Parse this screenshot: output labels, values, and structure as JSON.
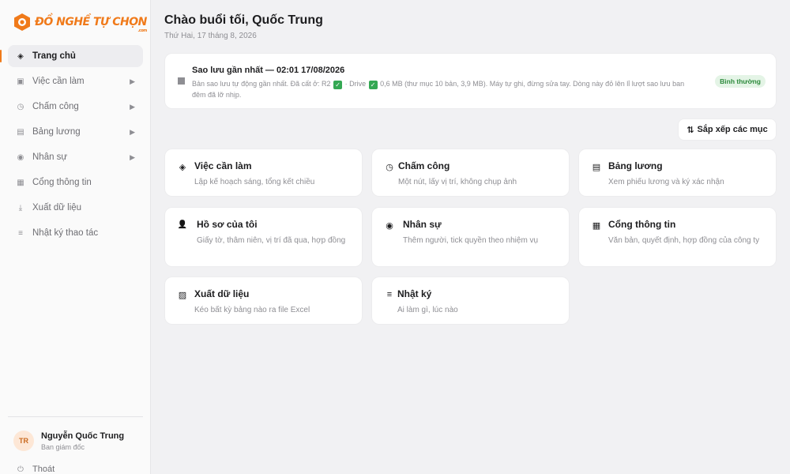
{
  "brand": {
    "name": "ĐỒ NGHỀ TỰ CHỌN",
    "sub": ".com"
  },
  "sidebar": {
    "items": [
      {
        "label": "Trang chủ",
        "icon": "diamond-icon",
        "glyph": "◈",
        "active": true,
        "arrow": false
      },
      {
        "label": "Việc cần làm",
        "icon": "square-icon",
        "glyph": "▣",
        "active": false,
        "arrow": true
      },
      {
        "label": "Chấm công",
        "icon": "clock-icon",
        "glyph": "◷",
        "active": false,
        "arrow": true
      },
      {
        "label": "Bảng lương",
        "icon": "grid-icon",
        "glyph": "▤",
        "active": false,
        "arrow": true
      },
      {
        "label": "Nhân sự",
        "icon": "circle-icon",
        "glyph": "◉",
        "active": false,
        "arrow": true
      },
      {
        "label": "Cổng thông tin",
        "icon": "block-icon",
        "glyph": "▦",
        "active": false,
        "arrow": false
      },
      {
        "label": "Xuất dữ liệu",
        "icon": "download-icon",
        "glyph": "⤓",
        "active": false,
        "arrow": false
      },
      {
        "label": "Nhật ký thao tác",
        "icon": "list-icon",
        "glyph": "≡",
        "active": false,
        "arrow": false
      }
    ],
    "arrow_glyph": "▶",
    "user": {
      "initials": "TR",
      "name": "Nguyễn Quốc Trung",
      "role": "Ban giám đốc"
    },
    "logout": {
      "label": "Thoát",
      "glyph": "⏻"
    }
  },
  "header": {
    "greeting": "Chào buổi tối, Quốc Trung",
    "date": "Thứ Hai, 17 tháng 8, 2026"
  },
  "backup": {
    "title": "Sao lưu gần nhất — 02:01 17/08/2026",
    "desc_part1": "Bản sao lưu tự động gần nhất. Đã cất ở: R2",
    "desc_part2": "· Drive",
    "desc_part3": "0,6 MB (thư mục 10 bản, 3,9 MB). Máy tự ghi, đừng sửa tay. Dòng này đỏ lên lỉ lượt sao lưu ban đêm đã lỡ nhịp.",
    "check_glyph": "✓",
    "status": "Bình thường",
    "colors": {
      "ok": "#34a853",
      "badge_bg": "#e4f4e6",
      "badge_text": "#2e8b3d"
    }
  },
  "sort_button": {
    "label": "Sắp xếp các mục",
    "glyph": "⇅"
  },
  "cards": [
    {
      "title": "Việc cần làm",
      "desc": "Lập kế hoạch sáng, tổng kết chiều",
      "icon": "diamond-icon",
      "glyph": "◈"
    },
    {
      "title": "Chấm công",
      "desc": "Một nút, lấy vị trí, không chụp ảnh",
      "icon": "clock-icon",
      "glyph": "◷"
    },
    {
      "title": "Bảng lương",
      "desc": "Xem phiếu lương và ký xác nhận",
      "icon": "grid-icon",
      "glyph": "▤"
    },
    {
      "title": "Hồ sơ của tôi",
      "desc": "Giấy tờ, thâm niên, vị trí đã qua, hợp đồng",
      "icon": "person-icon",
      "glyph": "👤"
    },
    {
      "title": "Nhân sự",
      "desc": "Thêm người, tick quyền theo nhiệm vụ",
      "icon": "circle-icon",
      "glyph": "◉"
    },
    {
      "title": "Cổng thông tin",
      "desc": "Văn bản, quyết định, hợp đồng của công ty",
      "icon": "block-icon",
      "glyph": "▦"
    },
    {
      "title": "Xuất dữ liệu",
      "desc": "Kéo bất kỳ bảng nào ra file Excel",
      "icon": "hatch-icon",
      "glyph": "▨"
    },
    {
      "title": "Nhật ký",
      "desc": "Ai làm gì, lúc nào",
      "icon": "list-icon",
      "glyph": "≡"
    }
  ],
  "colors": {
    "accent": "#f07a1a",
    "muted": "#8e8e93"
  }
}
